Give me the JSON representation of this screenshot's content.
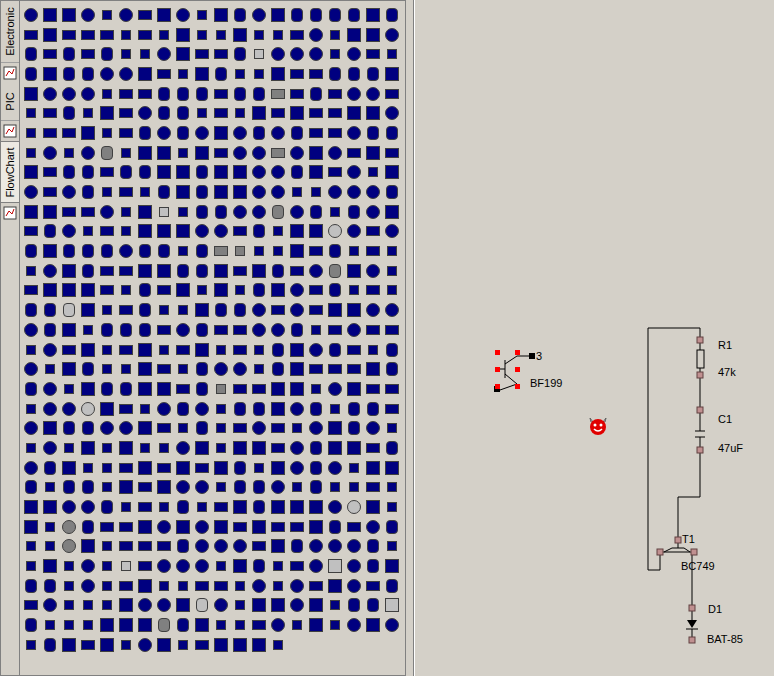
{
  "tabs": [
    {
      "label": "Electronic",
      "selected": false
    },
    {
      "label": "PIC",
      "selected": false
    },
    {
      "label": "FlowChart",
      "selected": true
    }
  ],
  "canvas": {
    "components": [
      {
        "designator": "3",
        "value": "BF199",
        "selected": true
      },
      {
        "designator": "R1",
        "value": "47k",
        "selected": false
      },
      {
        "designator": "C1",
        "value": "47uF",
        "selected": false
      },
      {
        "designator": "T1",
        "value": "BC749",
        "selected": false
      },
      {
        "designator": "D1",
        "value": "BAT-85",
        "selected": false
      }
    ]
  }
}
